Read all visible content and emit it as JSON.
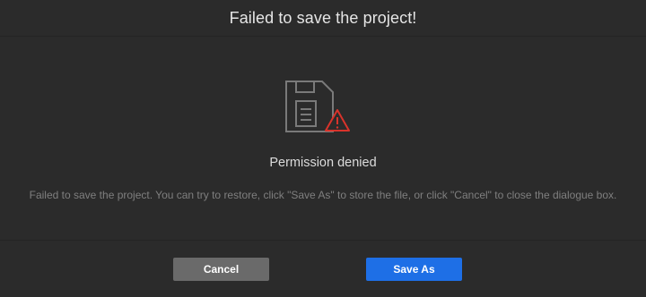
{
  "dialog": {
    "title": "Failed to save the project!",
    "heading": "Permission denied",
    "message": "Failed to save the project. You can try to restore, click \"Save As\" to store the file, or click \"Cancel\" to close the dialogue box.",
    "icon": "floppy-disk-warning-icon",
    "colors": {
      "background": "#2b2b2b",
      "warning": "#d9332b",
      "primary_button": "#1e6fe6",
      "secondary_button": "#6a6a6a"
    }
  },
  "buttons": {
    "cancel_label": "Cancel",
    "save_as_label": "Save As"
  }
}
